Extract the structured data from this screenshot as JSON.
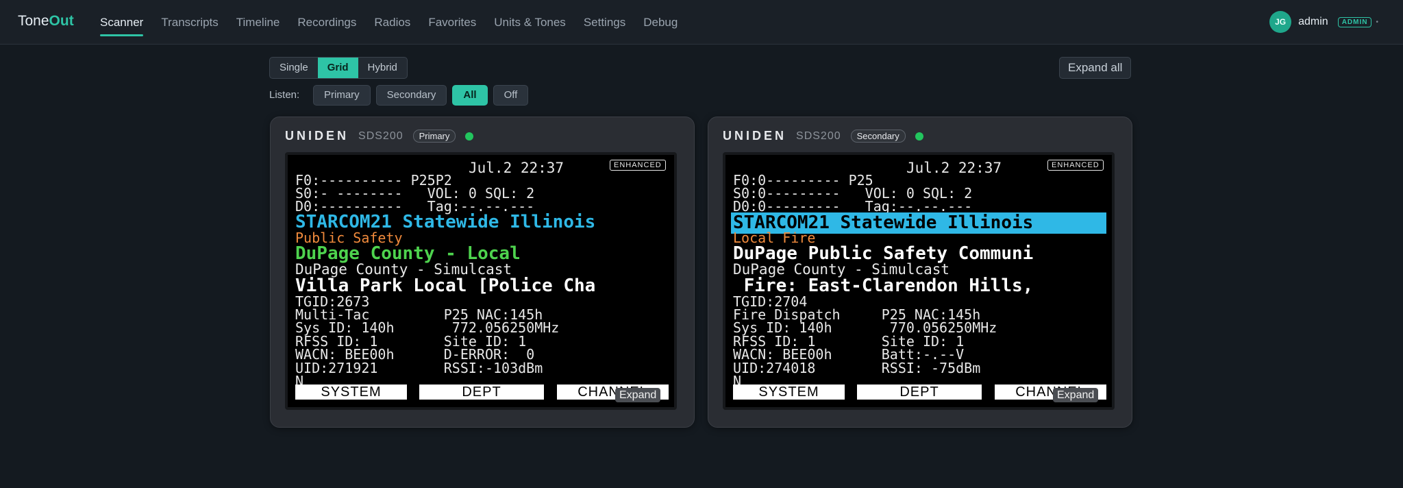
{
  "brand": {
    "part1": "Tone",
    "part2": "Out"
  },
  "nav": [
    {
      "label": "Scanner",
      "active": true
    },
    {
      "label": "Transcripts"
    },
    {
      "label": "Timeline"
    },
    {
      "label": "Recordings"
    },
    {
      "label": "Radios"
    },
    {
      "label": "Favorites"
    },
    {
      "label": "Units & Tones"
    },
    {
      "label": "Settings"
    },
    {
      "label": "Debug"
    }
  ],
  "user": {
    "initials": "JG",
    "name": "admin",
    "role": "ADMIN",
    "caret": "•"
  },
  "view_modes": [
    {
      "label": "Single"
    },
    {
      "label": "Grid",
      "active": true
    },
    {
      "label": "Hybrid"
    }
  ],
  "expand_all_label": "Expand all",
  "listen": {
    "label": "Listen:",
    "options": [
      {
        "label": "Primary"
      },
      {
        "label": "Secondary"
      },
      {
        "label": "All",
        "active": true
      },
      {
        "label": "Off"
      }
    ]
  },
  "colors": {
    "accent": "#2ec4a6",
    "status_on": "#22c55e",
    "cyan": "#2fb8e6",
    "orange": "#f08a3c",
    "green": "#4ed34e"
  },
  "scanners": [
    {
      "brand": "UNIDEN",
      "model": "SDS200",
      "role": "Primary",
      "enhanced": "ENHANCED",
      "lines": {
        "date": "Jul.2 22:37",
        "f0": "F0:---------- P25P2",
        "s0": "S0:- --------   VOL: 0 SQL: 2",
        "d0": "D0:----------   Tag:--.--.---",
        "system": "STARCOM21 Statewide Illinois",
        "category": "Public Safety",
        "department": "DuPage County - Local",
        "site": "DuPage County - Simulcast",
        "channel": "Villa Park Local [Police Cha",
        "tgid": "TGID:2673",
        "row1": "Multi-Tac         P25 NAC:145h",
        "row2": "Sys ID: 140h       772.056250MHz",
        "row3": "RFSS ID: 1        Site ID: 1",
        "row4": "WACN: BEE00h      D-ERROR:  0",
        "row5": "UID:271921        RSSI:-103dBm",
        "row6": "N"
      },
      "soft_keys": [
        "SYSTEM",
        "DEPT",
        "CHANNEL"
      ],
      "expand_label": "Expand"
    },
    {
      "brand": "UNIDEN",
      "model": "SDS200",
      "role": "Secondary",
      "enhanced": "ENHANCED",
      "lines": {
        "date": "Jul.2 22:37",
        "f0": "F0:0--------- P25",
        "s0": "S0:0---------   VOL: 0 SQL: 2",
        "d0": "D0:0---------   Tag:--.--.---",
        "system": "STARCOM21 Statewide Illinois",
        "category": "Local Fire",
        "department": "DuPage Public Safety Communi",
        "site": "DuPage County - Simulcast",
        "channel": " Fire: East-Clarendon Hills,",
        "tgid": "TGID:2704",
        "row1": "Fire Dispatch     P25 NAC:145h",
        "row2": "Sys ID: 140h       770.056250MHz",
        "row3": "RFSS ID: 1        Site ID: 1",
        "row4": "WACN: BEE00h      Batt:-.--V",
        "row5": "UID:274018        RSSI: -75dBm",
        "row6": "N"
      },
      "soft_keys": [
        "SYSTEM",
        "DEPT",
        "CHANNEL"
      ],
      "expand_label": "Expand"
    }
  ]
}
